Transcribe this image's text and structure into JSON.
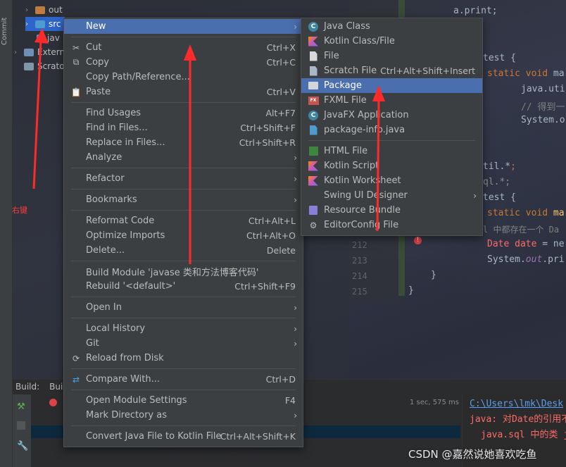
{
  "left_strip": {
    "label": "Commit"
  },
  "project_tree": {
    "items": [
      {
        "label": "out",
        "color": "#c07c41"
      },
      {
        "label": "src",
        "color": "#4d9bcf",
        "selected": true
      },
      {
        "label": "jav",
        "color": "#bbbbbb"
      },
      {
        "label": "Extern",
        "color": "#bbbbbb"
      },
      {
        "label": "Scrato",
        "color": "#bbbbbb"
      }
    ]
  },
  "editor": {
    "line_numbers": [
      "212",
      "213",
      "214",
      "215"
    ],
    "lines": {
      "l1": "a.print;",
      "l2": "test {",
      "l3_kw": "static void",
      "l3_rest": "ma",
      "l4": "java.uti",
      "l5": "// 得到一",
      "l6": "System.o",
      "l7_pre": "til.*",
      "l7_post": ";",
      "l8": "ql.*;",
      "l9": "test {",
      "l10_kw": "static void",
      "l10_fn": "ma",
      "l11": "l 中都存在一个 Da",
      "l12_kw": "Date date",
      "l12_rest": " = ne",
      "l13_a": "System.",
      "l13_b": "out",
      "l13_c": ".pri",
      "l14": "}",
      "l15": "}"
    }
  },
  "build": {
    "tab1": "Build:",
    "tab2": "Bui",
    "time": "1 sec, 575 ms",
    "console_link": "C:\\Users\\lmk\\Desk",
    "console_err1": "java: 对Date的引用不",
    "console_err2": "java.sql 中的类 j"
  },
  "main_menu": {
    "items": [
      {
        "label": "New",
        "shortcut": "",
        "submenu": true,
        "highlighted": true,
        "icon": ""
      },
      {
        "label": "Cut",
        "shortcut": "Ctrl+X",
        "icon": "scissors-icon"
      },
      {
        "label": "Copy",
        "shortcut": "Ctrl+C",
        "icon": "copy-icon"
      },
      {
        "label": "Copy Path/Reference...",
        "shortcut": ""
      },
      {
        "label": "Paste",
        "shortcut": "Ctrl+V",
        "icon": "clipboard-icon"
      },
      {
        "label": "Find Usages",
        "shortcut": "Alt+F7"
      },
      {
        "label": "Find in Files...",
        "shortcut": "Ctrl+Shift+F"
      },
      {
        "label": "Replace in Files...",
        "shortcut": "Ctrl+Shift+R"
      },
      {
        "label": "Analyze",
        "shortcut": "",
        "submenu": true
      },
      {
        "label": "Refactor",
        "shortcut": "",
        "submenu": true
      },
      {
        "label": "Bookmarks",
        "shortcut": "",
        "submenu": true
      },
      {
        "label": "Reformat Code",
        "shortcut": "Ctrl+Alt+L"
      },
      {
        "label": "Optimize Imports",
        "shortcut": "Ctrl+Alt+O"
      },
      {
        "label": "Delete...",
        "shortcut": "Delete"
      },
      {
        "label": "Build Module 'javase 类和方法博客代码'",
        "shortcut": ""
      },
      {
        "label": "Rebuild '<default>'",
        "shortcut": "Ctrl+Shift+F9"
      },
      {
        "label": "Open In",
        "shortcut": "",
        "submenu": true
      },
      {
        "label": "Local History",
        "shortcut": "",
        "submenu": true
      },
      {
        "label": "Git",
        "shortcut": "",
        "submenu": true
      },
      {
        "label": "Reload from Disk",
        "shortcut": "",
        "icon": "reload-icon"
      },
      {
        "label": "Compare With...",
        "shortcut": "Ctrl+D",
        "icon": "compare-icon"
      },
      {
        "label": "Open Module Settings",
        "shortcut": "F4"
      },
      {
        "label": "Mark Directory as",
        "shortcut": "",
        "submenu": true
      },
      {
        "label": "Convert Java File to Kotlin File",
        "shortcut": "Ctrl+Alt+Shift+K"
      }
    ]
  },
  "sub_menu": {
    "items": [
      {
        "label": "Java Class",
        "shortcut": "",
        "icon": "java-class-icon"
      },
      {
        "label": "Kotlin Class/File",
        "shortcut": "",
        "icon": "kotlin-icon"
      },
      {
        "label": "File",
        "shortcut": "",
        "icon": "file-icon"
      },
      {
        "label": "Scratch File",
        "shortcut": "Ctrl+Alt+Shift+Insert",
        "icon": "scratch-file-icon"
      },
      {
        "label": "Package",
        "shortcut": "",
        "icon": "package-icon",
        "highlighted": true
      },
      {
        "label": "FXML File",
        "shortcut": "",
        "icon": "fxml-icon"
      },
      {
        "label": "JavaFX Application",
        "shortcut": "",
        "icon": "javafx-icon"
      },
      {
        "label": "package-info.java",
        "shortcut": "",
        "icon": "package-info-icon"
      },
      {
        "label": "HTML File",
        "shortcut": "",
        "icon": "html-icon"
      },
      {
        "label": "Kotlin Script",
        "shortcut": "",
        "icon": "kotlin-script-icon"
      },
      {
        "label": "Kotlin Worksheet",
        "shortcut": "",
        "icon": "kotlin-worksheet-icon"
      },
      {
        "label": "Swing UI Designer",
        "shortcut": "",
        "submenu": true
      },
      {
        "label": "Resource Bundle",
        "shortcut": "",
        "icon": "resource-bundle-icon"
      },
      {
        "label": "EditorConfig File",
        "shortcut": "",
        "icon": "gear-icon"
      }
    ]
  },
  "annotations": {
    "right_click_label": "右键",
    "arrow_color": "#ff2a2a"
  },
  "watermark": "CSDN @嘉然说她喜欢吃鱼"
}
